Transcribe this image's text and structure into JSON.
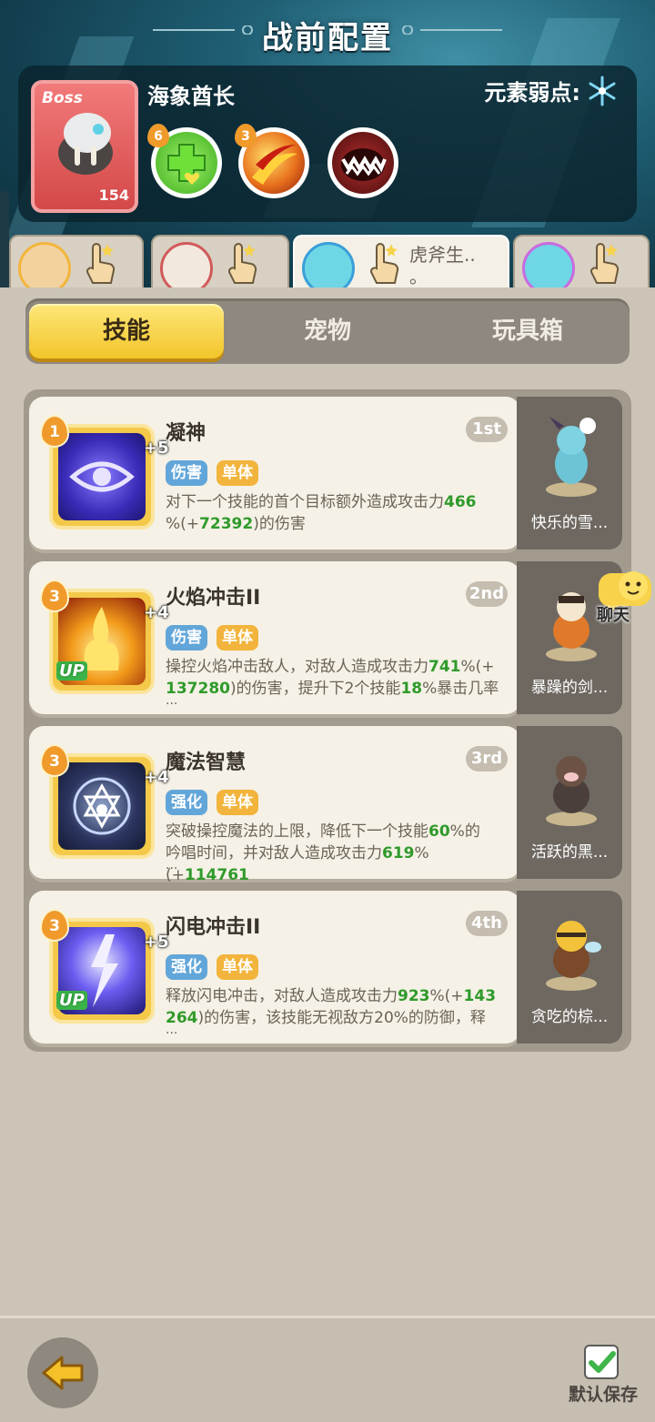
{
  "header": {
    "title": "战前配置"
  },
  "boss": {
    "tag": "Boss",
    "level": "154",
    "name": "海象酋长",
    "weakness_label": "元素弱点:",
    "weakness_icon": "snowflake-icon",
    "skills": [
      {
        "badge": "6",
        "icon": "heal-cross-icon",
        "color": "#5ed13a"
      },
      {
        "badge": "3",
        "icon": "fire-slash-icon",
        "color": "#e8701c"
      },
      {
        "badge": "",
        "icon": "monster-mouth-icon",
        "color": "#7a1c1c"
      }
    ]
  },
  "hero_tabs": [
    {
      "name": "",
      "active": false
    },
    {
      "name": "",
      "active": false
    },
    {
      "name": "虎斧生..",
      "extra": "。",
      "active": true
    },
    {
      "name": "",
      "active": false
    }
  ],
  "segments": [
    {
      "label": "技能",
      "active": true
    },
    {
      "label": "宠物",
      "active": false
    },
    {
      "label": "玩具箱",
      "active": false
    }
  ],
  "cards": [
    {
      "name": "凝神",
      "rank": "1st",
      "level": "1",
      "plus": "+5",
      "up": "",
      "tags": [
        "伤害",
        "单体"
      ],
      "desc_line1_pre": "对下一个技能的首个目标额外造成攻击力",
      "desc_line1_val": "466",
      "desc_line2_pre": "%(+",
      "desc_line2_val": "72392",
      "desc_line2_post": ")的伤害",
      "dots": "",
      "pet_name": "快乐的雪..."
    },
    {
      "name": "火焰冲击II",
      "rank": "2nd",
      "level": "3",
      "plus": "+4",
      "up": "UP",
      "tags": [
        "伤害",
        "单体"
      ],
      "desc_line1_pre": "操控火焰冲击敌人，对敌人造成攻击力",
      "desc_line1_val": "741",
      "desc_line1_post": "%(+",
      "desc_line2_val": "137280",
      "desc_line2_mid": ")的伤害，提升下2个技能",
      "desc_line2_val2": "18",
      "desc_line2_post": "%暴击几率",
      "dots": "...",
      "pet_name": "暴躁的剑..."
    },
    {
      "name": "魔法智慧",
      "rank": "3rd",
      "level": "3",
      "plus": "+4",
      "up": "",
      "tags": [
        "强化",
        "单体"
      ],
      "desc_line1_pre": "突破操控魔法的上限，降低下一个技能",
      "desc_line1_val": "60",
      "desc_line1_post": "%的",
      "desc_line2_pre": "吟唱时间，并对敌人造成攻击力",
      "desc_line2_val": "619",
      "desc_line2_mid": "%(+",
      "desc_line2_val2": "114761",
      "dots": "...",
      "pet_name": "活跃的黑..."
    },
    {
      "name": "闪电冲击II",
      "rank": "4th",
      "level": "3",
      "plus": "+5",
      "up": "UP",
      "tags": [
        "强化",
        "单体"
      ],
      "desc_line1_pre": "释放闪电冲击，对敌人造成攻击力",
      "desc_line1_val": "923",
      "desc_line1_post": "%(+",
      "desc_line1_val2": "143",
      "desc_line2_val": "264",
      "desc_line2_post": ")的伤害，该技能无视敌方20%的防御，释",
      "dots": "...",
      "pet_name": "贪吃的棕..."
    }
  ],
  "chat": {
    "label": "聊天"
  },
  "footer": {
    "save_label": "默认保存",
    "back_icon": "back-arrow-icon"
  }
}
